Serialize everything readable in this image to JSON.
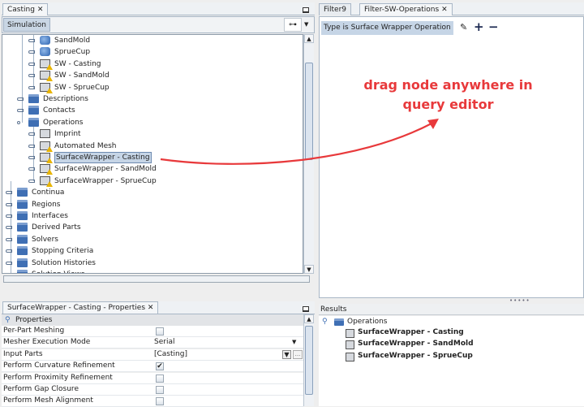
{
  "left_panel": {
    "tab": "Casting",
    "toolbar_tab": "Simulation",
    "tree": [
      {
        "label": "SandMold",
        "level": 3,
        "icon": "part-icon"
      },
      {
        "label": "SprueCup",
        "level": 3,
        "icon": "part-icon"
      },
      {
        "label": "SW - Casting",
        "level": 3,
        "icon": "operation-warning-icon"
      },
      {
        "label": "SW - SandMold",
        "level": 3,
        "icon": "operation-warning-icon"
      },
      {
        "label": "SW - SprueCup",
        "level": 3,
        "icon": "operation-warning-icon"
      },
      {
        "label": "Descriptions",
        "level": 2,
        "icon": "folder-icon"
      },
      {
        "label": "Contacts",
        "level": 2,
        "icon": "folder-icon"
      },
      {
        "label": "Operations",
        "level": 2,
        "icon": "folder-icon",
        "expanded": true
      },
      {
        "label": "Imprint",
        "level": 3,
        "icon": "imprint-icon"
      },
      {
        "label": "Automated Mesh",
        "level": 3,
        "icon": "operation-warning-icon"
      },
      {
        "label": "SurfaceWrapper - Casting",
        "level": 3,
        "icon": "operation-warning-icon",
        "selected": true
      },
      {
        "label": "SurfaceWrapper - SandMold",
        "level": 3,
        "icon": "operation-warning-icon"
      },
      {
        "label": "SurfaceWrapper - SprueCup",
        "level": 3,
        "icon": "operation-warning-icon"
      },
      {
        "label": "Continua",
        "level": 1,
        "icon": "folder-icon"
      },
      {
        "label": "Regions",
        "level": 1,
        "icon": "folder-icon"
      },
      {
        "label": "Interfaces",
        "level": 1,
        "icon": "folder-icon"
      },
      {
        "label": "Derived Parts",
        "level": 1,
        "icon": "folder-icon"
      },
      {
        "label": "Solvers",
        "level": 1,
        "icon": "folder-icon"
      },
      {
        "label": "Stopping Criteria",
        "level": 1,
        "icon": "folder-icon"
      },
      {
        "label": "Solution Histories",
        "level": 1,
        "icon": "folder-icon"
      },
      {
        "label": "Solution Views",
        "level": 1,
        "icon": "folder-icon"
      }
    ]
  },
  "properties_panel": {
    "tab": "SurfaceWrapper - Casting - Properties",
    "section": "Properties",
    "rows": [
      {
        "key": "Per-Part Meshing",
        "type": "checkbox",
        "checked": false
      },
      {
        "key": "Mesher Execution Mode",
        "type": "select",
        "value": "Serial"
      },
      {
        "key": "Input Parts",
        "type": "text",
        "value": "[Casting]"
      },
      {
        "key": "Perform Curvature Refinement",
        "type": "checkbox",
        "checked": true
      },
      {
        "key": "Perform Proximity Refinement",
        "type": "checkbox",
        "checked": false
      },
      {
        "key": "Perform Gap Closure",
        "type": "checkbox",
        "checked": false
      },
      {
        "key": "Perform Mesh Alignment",
        "type": "checkbox",
        "checked": false
      }
    ],
    "ellipsis": "..."
  },
  "right_panel": {
    "tabs": [
      "Filter9",
      "Filter-SW-Operations"
    ],
    "query": "Type is Surface Wrapper Operation",
    "results_label": "Results",
    "results_root": "Operations",
    "results": [
      "SurfaceWrapper - Casting",
      "SurfaceWrapper - SandMold",
      "SurfaceWrapper - SprueCup"
    ]
  },
  "annotation": {
    "line1": "drag node anywhere in",
    "line2": "query editor",
    "color": "#e8393b"
  }
}
